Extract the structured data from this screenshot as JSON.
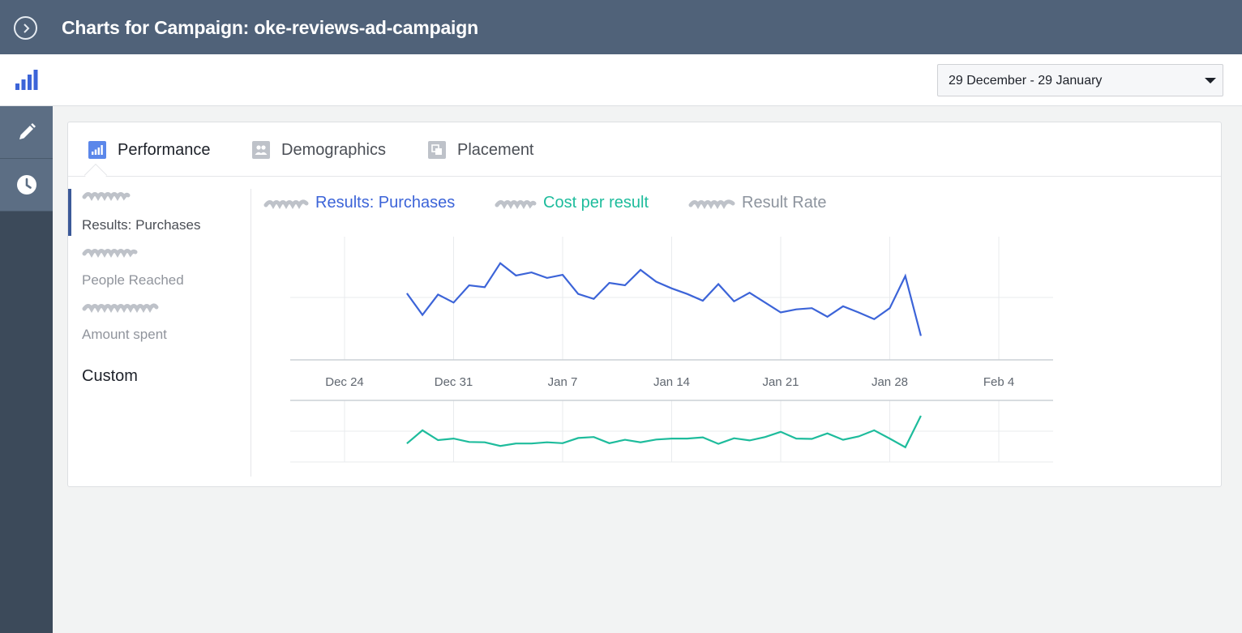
{
  "header": {
    "title": "Charts for Campaign: oke-reviews-ad-campaign"
  },
  "date_range": {
    "value": "29 December - 29 January"
  },
  "tabs": [
    {
      "label": "Performance",
      "icon": "bar-chart-icon"
    },
    {
      "label": "Demographics",
      "icon": "people-icon"
    },
    {
      "label": "Placement",
      "icon": "placement-icon"
    }
  ],
  "metrics": [
    {
      "label": "Results: Purchases"
    },
    {
      "label": "People Reached"
    },
    {
      "label": "Amount spent"
    }
  ],
  "custom_label": "Custom",
  "legend": [
    {
      "label": "Results: Purchases",
      "color": "#3c64d8"
    },
    {
      "label": "Cost per result",
      "color": "#1ebc9c"
    },
    {
      "label": "Result Rate",
      "color": "#8d949e"
    }
  ],
  "colors": {
    "topbar": "#506279",
    "sidebar": "#3c4a5a",
    "accent": "#3b5998",
    "purchases": "#3c64d8",
    "cost": "#1ebc9c"
  },
  "chart_data": [
    {
      "type": "line",
      "title": "",
      "x_tick_labels": [
        "Dec 24",
        "Dec 31",
        "Jan 7",
        "Jan 14",
        "Jan 21",
        "Jan 28",
        "Feb 4"
      ],
      "x_range": [
        "Dec 21",
        "Feb 7"
      ],
      "grid": true,
      "y_tick_labels_shown": false,
      "series": [
        {
          "name": "Results: Purchases",
          "x": [
            "Dec 28",
            "Dec 29",
            "Dec 30",
            "Dec 31",
            "Jan 1",
            "Jan 2",
            "Jan 3",
            "Jan 4",
            "Jan 5",
            "Jan 6",
            "Jan 7",
            "Jan 8",
            "Jan 9",
            "Jan 10",
            "Jan 11",
            "Jan 12",
            "Jan 13",
            "Jan 14",
            "Jan 15",
            "Jan 16",
            "Jan 17",
            "Jan 18",
            "Jan 19",
            "Jan 20",
            "Jan 21",
            "Jan 22",
            "Jan 23",
            "Jan 24",
            "Jan 25",
            "Jan 26",
            "Jan 27",
            "Jan 28",
            "Jan 29",
            "Jan 30"
          ],
          "values": [
            1.08,
            0.73,
            1.06,
            0.93,
            1.21,
            1.18,
            1.57,
            1.37,
            1.42,
            1.33,
            1.38,
            1.07,
            0.99,
            1.25,
            1.21,
            1.46,
            1.27,
            1.16,
            1.07,
            0.96,
            1.23,
            0.95,
            1.09,
            0.93,
            0.77,
            0.82,
            0.84,
            0.7,
            0.87,
            0.77,
            0.66,
            0.84,
            1.36,
            0.39
          ]
        }
      ]
    },
    {
      "type": "line",
      "title": "",
      "x_tick_labels": [
        "Dec 24",
        "Dec 31",
        "Jan 7",
        "Jan 14",
        "Jan 21",
        "Jan 28",
        "Feb 4"
      ],
      "grid": true,
      "y_tick_labels_shown": false,
      "series": [
        {
          "name": "Cost per result",
          "x": [
            "Dec 28",
            "Dec 29",
            "Dec 30",
            "Dec 31",
            "Jan 1",
            "Jan 2",
            "Jan 3",
            "Jan 4",
            "Jan 5",
            "Jan 6",
            "Jan 7",
            "Jan 8",
            "Jan 9",
            "Jan 10",
            "Jan 11",
            "Jan 12",
            "Jan 13",
            "Jan 14",
            "Jan 15",
            "Jan 16",
            "Jan 17",
            "Jan 18",
            "Jan 19",
            "Jan 20",
            "Jan 21",
            "Jan 22",
            "Jan 23",
            "Jan 24",
            "Jan 25",
            "Jan 26",
            "Jan 27",
            "Jan 28",
            "Jan 29",
            "Jan 30"
          ],
          "values": [
            0.6,
            1.03,
            0.71,
            0.76,
            0.65,
            0.64,
            0.52,
            0.6,
            0.6,
            0.64,
            0.61,
            0.78,
            0.81,
            0.61,
            0.72,
            0.64,
            0.73,
            0.76,
            0.76,
            0.8,
            0.59,
            0.77,
            0.7,
            0.81,
            0.98,
            0.76,
            0.75,
            0.93,
            0.72,
            0.83,
            1.03,
            0.76,
            0.48,
            1.5
          ]
        }
      ]
    }
  ]
}
